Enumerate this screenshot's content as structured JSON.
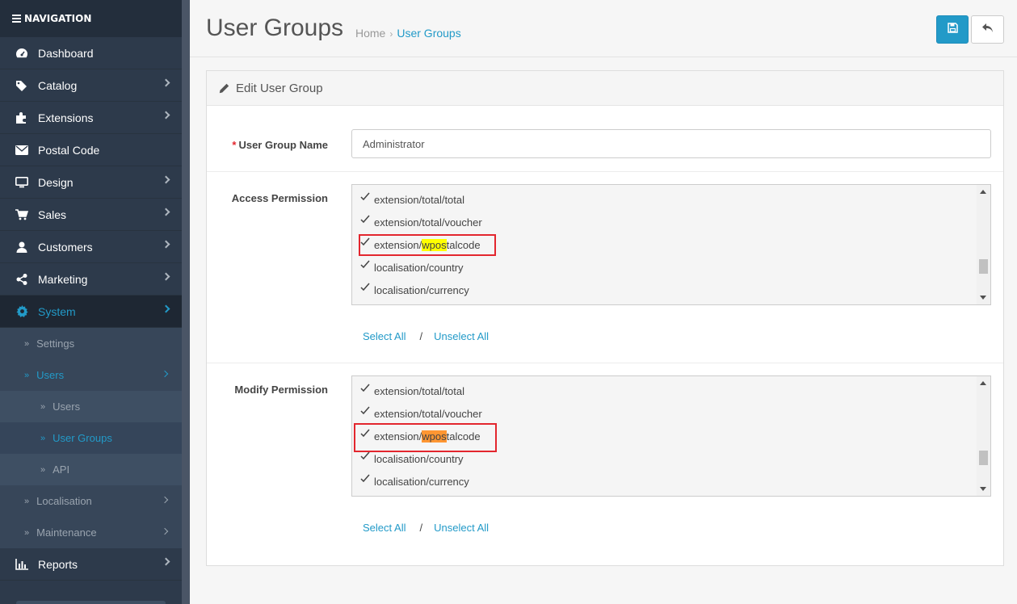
{
  "sidebar": {
    "header": "NAVIGATION",
    "items": [
      {
        "label": "Dashboard",
        "icon": "dashboard-icon"
      },
      {
        "label": "Catalog",
        "icon": "tags-icon"
      },
      {
        "label": "Extensions",
        "icon": "puzzle-icon"
      },
      {
        "label": "Postal Code",
        "icon": "envelope-icon"
      },
      {
        "label": "Design",
        "icon": "desktop-icon"
      },
      {
        "label": "Sales",
        "icon": "cart-icon"
      },
      {
        "label": "Customers",
        "icon": "user-icon"
      },
      {
        "label": "Marketing",
        "icon": "share-icon"
      },
      {
        "label": "System",
        "icon": "gear-icon"
      }
    ],
    "system_sub": {
      "settings": "Settings",
      "users": "Users",
      "users_sub": [
        "Users",
        "User Groups",
        "API"
      ],
      "localisation": "Localisation",
      "maintenance": "Maintenance"
    },
    "reports": "Reports"
  },
  "header": {
    "title": "User Groups",
    "breadcrumb": [
      "Home",
      "User Groups"
    ]
  },
  "panel": {
    "heading": "Edit User Group",
    "name_label": "User Group Name",
    "name_value": "Administrator",
    "access_label": "Access Permission",
    "modify_label": "Modify Permission",
    "permissions": [
      {
        "prefix": "extension/total/total",
        "hl": "",
        "suffix": ""
      },
      {
        "prefix": "extension/total/voucher",
        "hl": "",
        "suffix": ""
      },
      {
        "prefix": "extension/",
        "hl": "wpos",
        "suffix": "talcode"
      },
      {
        "prefix": "localisation/country",
        "hl": "",
        "suffix": ""
      },
      {
        "prefix": "localisation/currency",
        "hl": "",
        "suffix": ""
      }
    ],
    "select_all": "Select All",
    "slash": "/",
    "unselect_all": "Unselect All"
  },
  "colors": {
    "accent": "#229ac8",
    "highlight_access": "#ffff00",
    "highlight_modify": "#ff9632",
    "annotation": "#e3262e"
  }
}
